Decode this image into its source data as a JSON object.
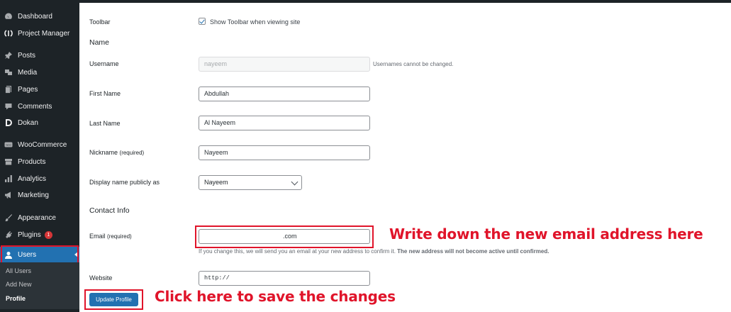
{
  "sidebar": {
    "items": [
      {
        "label": "Dashboard",
        "icon": "dashboard-icon"
      },
      {
        "label": "Project Manager",
        "icon": "project-manager-icon"
      },
      {
        "label": "Posts",
        "icon": "pin-icon"
      },
      {
        "label": "Media",
        "icon": "media-icon"
      },
      {
        "label": "Pages",
        "icon": "pages-icon"
      },
      {
        "label": "Comments",
        "icon": "comment-icon"
      },
      {
        "label": "Dokan",
        "icon": "dokan-icon"
      },
      {
        "label": "WooCommerce",
        "icon": "woocommerce-icon"
      },
      {
        "label": "Products",
        "icon": "archive-icon"
      },
      {
        "label": "Analytics",
        "icon": "bar-chart-icon"
      },
      {
        "label": "Marketing",
        "icon": "megaphone-icon"
      },
      {
        "label": "Appearance",
        "icon": "paintbrush-icon"
      },
      {
        "label": "Plugins",
        "icon": "plug-icon",
        "badge": "1"
      },
      {
        "label": "Users",
        "icon": "user-icon"
      }
    ],
    "submenu": [
      {
        "label": "All Users"
      },
      {
        "label": "Add New"
      },
      {
        "label": "Profile"
      }
    ]
  },
  "form": {
    "toolbar": {
      "label": "Toolbar",
      "checkbox_label": "Show Toolbar when viewing site",
      "checked": true
    },
    "name_heading": "Name",
    "username": {
      "label": "Username",
      "value": "nayeem",
      "note": "Usernames cannot be changed."
    },
    "first_name": {
      "label": "First Name",
      "value": "Abdullah"
    },
    "last_name": {
      "label": "Last Name",
      "value": "Al Nayeem"
    },
    "nickname": {
      "label": "Nickname",
      "required": "(required)",
      "value": "Nayeem"
    },
    "display_name": {
      "label": "Display name publicly as",
      "value": "Nayeem"
    },
    "contact_heading": "Contact Info",
    "email": {
      "label": "Email",
      "required": "(required)",
      "value": ".com",
      "note": "If you change this, we will send you an email at your new address to confirm it.",
      "note_bold": "The new address will not become active until confirmed."
    },
    "website": {
      "label": "Website",
      "value": "http://"
    },
    "update_button": "Update Profile"
  },
  "annotations": {
    "email": "Write down the new email address here",
    "save": "Click here to save the changes",
    "color": "#e0142a"
  },
  "colors": {
    "accent": "#2271b1",
    "sidebar": "#1d2327",
    "highlight": "#e0142a"
  }
}
